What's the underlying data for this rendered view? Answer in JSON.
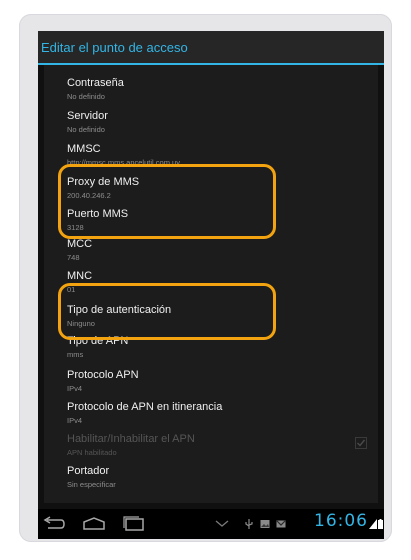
{
  "dialog": {
    "title": "Editar el punto de acceso"
  },
  "items": [
    {
      "title": "Contraseña",
      "subtitle": "No definido"
    },
    {
      "title": "Servidor",
      "subtitle": "No definido"
    },
    {
      "title": "MMSC",
      "subtitle": "http://mmsc.mms.ancelutil.com.uy"
    },
    {
      "title": "Proxy de MMS",
      "subtitle": "200.40.246.2"
    },
    {
      "title": "Puerto MMS",
      "subtitle": "3128"
    },
    {
      "title": "MCC",
      "subtitle": "748"
    },
    {
      "title": "MNC",
      "subtitle": "01"
    },
    {
      "title": "Tipo de autenticación",
      "subtitle": "Ninguno"
    },
    {
      "title": "Tipo de APN",
      "subtitle": "mms"
    },
    {
      "title": "Protocolo APN",
      "subtitle": "IPv4"
    },
    {
      "title": "Protocolo de APN en itinerancia",
      "subtitle": "IPv4"
    },
    {
      "title": "Habilitar/Inhabilitar el APN",
      "subtitle": "APN habilitado",
      "enabled": false,
      "checked": true
    },
    {
      "title": "Portador",
      "subtitle": "Sin especificar"
    }
  ],
  "statusbar": {
    "time": "16:06"
  },
  "colors": {
    "accent": "#33b5e5",
    "highlight": "#f2a30f"
  },
  "icons": [
    "back-icon",
    "home-icon",
    "recent-apps-icon",
    "notifications-chevron-icon",
    "usb-icon",
    "image-icon",
    "gmail-icon",
    "signal-icon",
    "battery-icon"
  ]
}
